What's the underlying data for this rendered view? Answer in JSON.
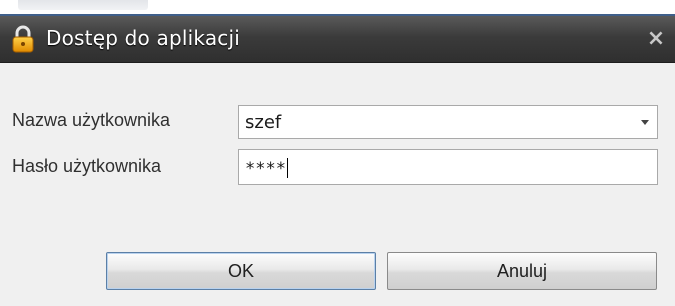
{
  "dialog": {
    "title": "Dostęp do aplikacji",
    "close_symbol": "×",
    "title_icon": "padlock-icon"
  },
  "form": {
    "username_label": "Nazwa użytkownika",
    "username_value": "szef",
    "password_label": "Hasło użytkownika",
    "password_value": "****"
  },
  "buttons": {
    "ok_label": "OK",
    "cancel_label": "Anuluj"
  }
}
